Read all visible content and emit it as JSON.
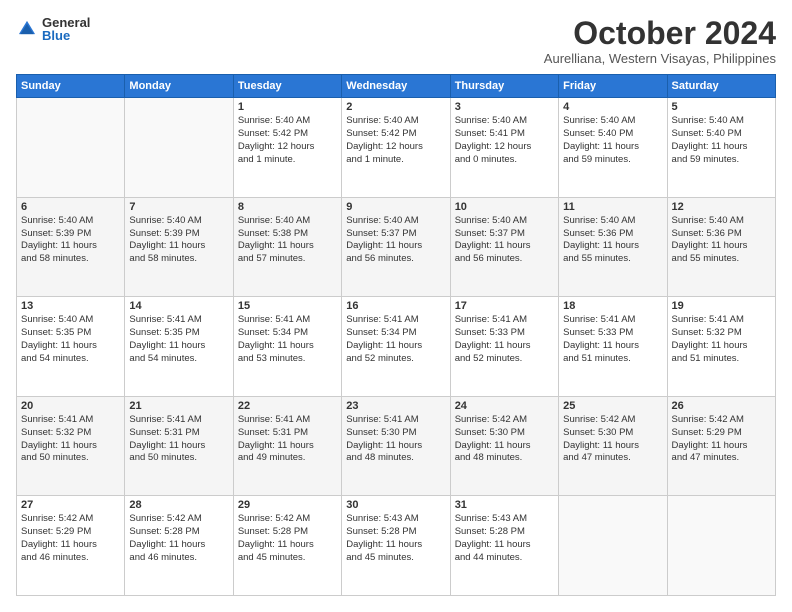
{
  "logo": {
    "general": "General",
    "blue": "Blue"
  },
  "header": {
    "month": "October 2024",
    "location": "Aurelliana, Western Visayas, Philippines"
  },
  "weekdays": [
    "Sunday",
    "Monday",
    "Tuesday",
    "Wednesday",
    "Thursday",
    "Friday",
    "Saturday"
  ],
  "weeks": [
    [
      {
        "day": "",
        "info": ""
      },
      {
        "day": "",
        "info": ""
      },
      {
        "day": "1",
        "info": "Sunrise: 5:40 AM\nSunset: 5:42 PM\nDaylight: 12 hours\nand 1 minute."
      },
      {
        "day": "2",
        "info": "Sunrise: 5:40 AM\nSunset: 5:42 PM\nDaylight: 12 hours\nand 1 minute."
      },
      {
        "day": "3",
        "info": "Sunrise: 5:40 AM\nSunset: 5:41 PM\nDaylight: 12 hours\nand 0 minutes."
      },
      {
        "day": "4",
        "info": "Sunrise: 5:40 AM\nSunset: 5:40 PM\nDaylight: 11 hours\nand 59 minutes."
      },
      {
        "day": "5",
        "info": "Sunrise: 5:40 AM\nSunset: 5:40 PM\nDaylight: 11 hours\nand 59 minutes."
      }
    ],
    [
      {
        "day": "6",
        "info": "Sunrise: 5:40 AM\nSunset: 5:39 PM\nDaylight: 11 hours\nand 58 minutes."
      },
      {
        "day": "7",
        "info": "Sunrise: 5:40 AM\nSunset: 5:39 PM\nDaylight: 11 hours\nand 58 minutes."
      },
      {
        "day": "8",
        "info": "Sunrise: 5:40 AM\nSunset: 5:38 PM\nDaylight: 11 hours\nand 57 minutes."
      },
      {
        "day": "9",
        "info": "Sunrise: 5:40 AM\nSunset: 5:37 PM\nDaylight: 11 hours\nand 56 minutes."
      },
      {
        "day": "10",
        "info": "Sunrise: 5:40 AM\nSunset: 5:37 PM\nDaylight: 11 hours\nand 56 minutes."
      },
      {
        "day": "11",
        "info": "Sunrise: 5:40 AM\nSunset: 5:36 PM\nDaylight: 11 hours\nand 55 minutes."
      },
      {
        "day": "12",
        "info": "Sunrise: 5:40 AM\nSunset: 5:36 PM\nDaylight: 11 hours\nand 55 minutes."
      }
    ],
    [
      {
        "day": "13",
        "info": "Sunrise: 5:40 AM\nSunset: 5:35 PM\nDaylight: 11 hours\nand 54 minutes."
      },
      {
        "day": "14",
        "info": "Sunrise: 5:41 AM\nSunset: 5:35 PM\nDaylight: 11 hours\nand 54 minutes."
      },
      {
        "day": "15",
        "info": "Sunrise: 5:41 AM\nSunset: 5:34 PM\nDaylight: 11 hours\nand 53 minutes."
      },
      {
        "day": "16",
        "info": "Sunrise: 5:41 AM\nSunset: 5:34 PM\nDaylight: 11 hours\nand 52 minutes."
      },
      {
        "day": "17",
        "info": "Sunrise: 5:41 AM\nSunset: 5:33 PM\nDaylight: 11 hours\nand 52 minutes."
      },
      {
        "day": "18",
        "info": "Sunrise: 5:41 AM\nSunset: 5:33 PM\nDaylight: 11 hours\nand 51 minutes."
      },
      {
        "day": "19",
        "info": "Sunrise: 5:41 AM\nSunset: 5:32 PM\nDaylight: 11 hours\nand 51 minutes."
      }
    ],
    [
      {
        "day": "20",
        "info": "Sunrise: 5:41 AM\nSunset: 5:32 PM\nDaylight: 11 hours\nand 50 minutes."
      },
      {
        "day": "21",
        "info": "Sunrise: 5:41 AM\nSunset: 5:31 PM\nDaylight: 11 hours\nand 50 minutes."
      },
      {
        "day": "22",
        "info": "Sunrise: 5:41 AM\nSunset: 5:31 PM\nDaylight: 11 hours\nand 49 minutes."
      },
      {
        "day": "23",
        "info": "Sunrise: 5:41 AM\nSunset: 5:30 PM\nDaylight: 11 hours\nand 48 minutes."
      },
      {
        "day": "24",
        "info": "Sunrise: 5:42 AM\nSunset: 5:30 PM\nDaylight: 11 hours\nand 48 minutes."
      },
      {
        "day": "25",
        "info": "Sunrise: 5:42 AM\nSunset: 5:30 PM\nDaylight: 11 hours\nand 47 minutes."
      },
      {
        "day": "26",
        "info": "Sunrise: 5:42 AM\nSunset: 5:29 PM\nDaylight: 11 hours\nand 47 minutes."
      }
    ],
    [
      {
        "day": "27",
        "info": "Sunrise: 5:42 AM\nSunset: 5:29 PM\nDaylight: 11 hours\nand 46 minutes."
      },
      {
        "day": "28",
        "info": "Sunrise: 5:42 AM\nSunset: 5:28 PM\nDaylight: 11 hours\nand 46 minutes."
      },
      {
        "day": "29",
        "info": "Sunrise: 5:42 AM\nSunset: 5:28 PM\nDaylight: 11 hours\nand 45 minutes."
      },
      {
        "day": "30",
        "info": "Sunrise: 5:43 AM\nSunset: 5:28 PM\nDaylight: 11 hours\nand 45 minutes."
      },
      {
        "day": "31",
        "info": "Sunrise: 5:43 AM\nSunset: 5:28 PM\nDaylight: 11 hours\nand 44 minutes."
      },
      {
        "day": "",
        "info": ""
      },
      {
        "day": "",
        "info": ""
      }
    ]
  ]
}
